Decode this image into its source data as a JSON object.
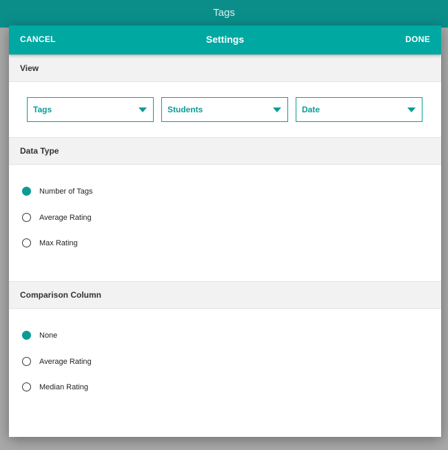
{
  "app_bar": {
    "title": "Tags"
  },
  "dialog": {
    "cancel_label": "CANCEL",
    "title": "Settings",
    "done_label": "DONE"
  },
  "view": {
    "header": "View",
    "selects": [
      {
        "value": "Tags"
      },
      {
        "value": "Students"
      },
      {
        "value": "Date"
      }
    ]
  },
  "data_type": {
    "header": "Data Type",
    "options": [
      {
        "label": "Number of Tags",
        "checked": true
      },
      {
        "label": "Average Rating",
        "checked": false
      },
      {
        "label": "Max Rating",
        "checked": false
      }
    ]
  },
  "comparison": {
    "header": "Comparison Column",
    "options": [
      {
        "label": "None",
        "checked": true
      },
      {
        "label": "Average Rating",
        "checked": false
      },
      {
        "label": "Median Rating",
        "checked": false
      }
    ]
  },
  "colors": {
    "accent": "#00a8a2",
    "app_bar": "#0b8e8a",
    "overlay": "#a9a9a9"
  }
}
